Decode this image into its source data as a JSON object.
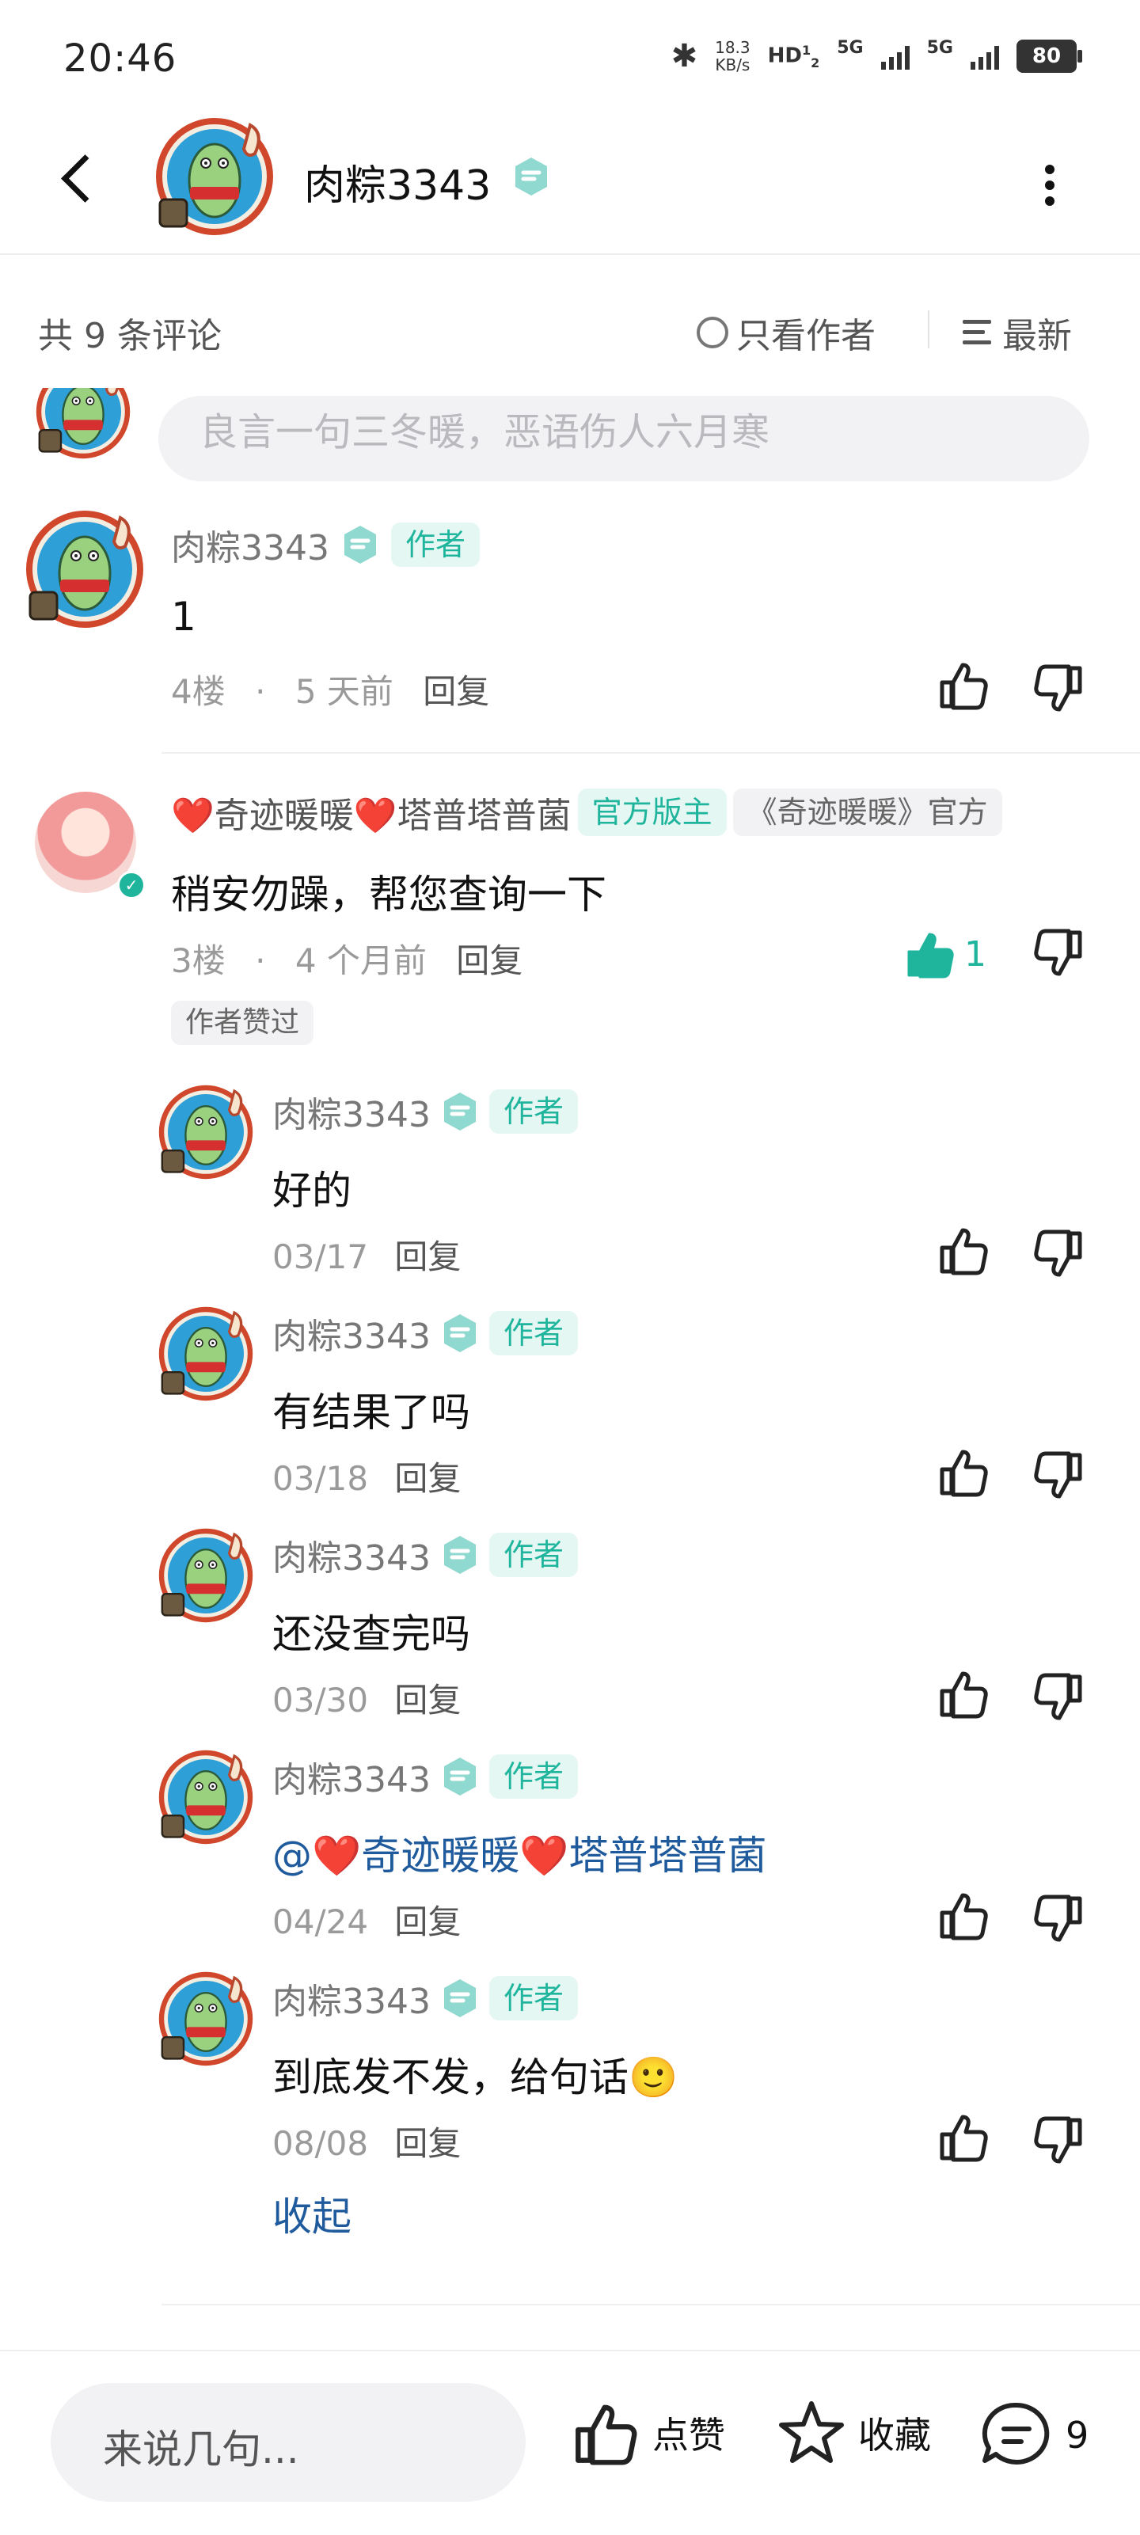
{
  "status_bar": {
    "time": "20:46",
    "net_speed_value": "18.3",
    "net_speed_unit": "KB/s",
    "hd_label": "HD",
    "sim_labels": [
      "1",
      "2"
    ],
    "network_labels": [
      "5G",
      "5G"
    ],
    "battery": "80",
    "icons": [
      "bluetooth-icon",
      "hd-icon",
      "signal-icon",
      "battery-icon"
    ]
  },
  "header": {
    "title": "肉粽3343",
    "icons": [
      "back-icon",
      "verified-badge-icon",
      "more-icon"
    ]
  },
  "comment_bar": {
    "count_label": "共 9 条评论",
    "author_only_label": "只看作者",
    "sort_label": "最新"
  },
  "reply_box_top": {
    "placeholder": "良言一句三冬暖，恶语伤人六月寒"
  },
  "comments": [
    {
      "user": "肉粽3343",
      "tag": "作者",
      "text": "1",
      "floor": "4楼",
      "dot": "·",
      "time": "5 天前",
      "reply": "回复"
    },
    {
      "user": "❤️奇迹暖暖❤️塔普塔普菌",
      "tags": [
        "官方版主",
        "《奇迹暖暖》官方"
      ],
      "text": "稍安勿躁，帮您查询一下",
      "floor": "3楼",
      "dot": "·",
      "time": "4 个月前",
      "reply": "回复",
      "likes": "1",
      "liked_badge": "作者赞过"
    }
  ],
  "replies": [
    {
      "user": "肉粽3343",
      "tag": "作者",
      "text": "好的",
      "date": "03/17",
      "reply": "回复"
    },
    {
      "user": "肉粽3343",
      "tag": "作者",
      "text": "有结果了吗",
      "date": "03/18",
      "reply": "回复"
    },
    {
      "user": "肉粽3343",
      "tag": "作者",
      "text": "还没查完吗",
      "date": "03/30",
      "reply": "回复"
    },
    {
      "user": "肉粽3343",
      "tag": "作者",
      "text": "@❤️奇迹暖暖❤️塔普塔普菌",
      "date": "04/24",
      "reply": "回复"
    },
    {
      "user": "肉粽3343",
      "tag": "作者",
      "text": "到底发不发，给句话🙂",
      "date": "08/08",
      "reply": "回复"
    }
  ],
  "collapse_label": "收起",
  "bottom_bar": {
    "input_placeholder": "来说几句...",
    "like_label": "点赞",
    "favorite_label": "收藏",
    "comment_count": "9"
  },
  "colors": {
    "accent": "#1fb59c",
    "link": "#1e5a9c",
    "muted": "#9a9a9a",
    "tag_bg": "#e4f7f3"
  }
}
